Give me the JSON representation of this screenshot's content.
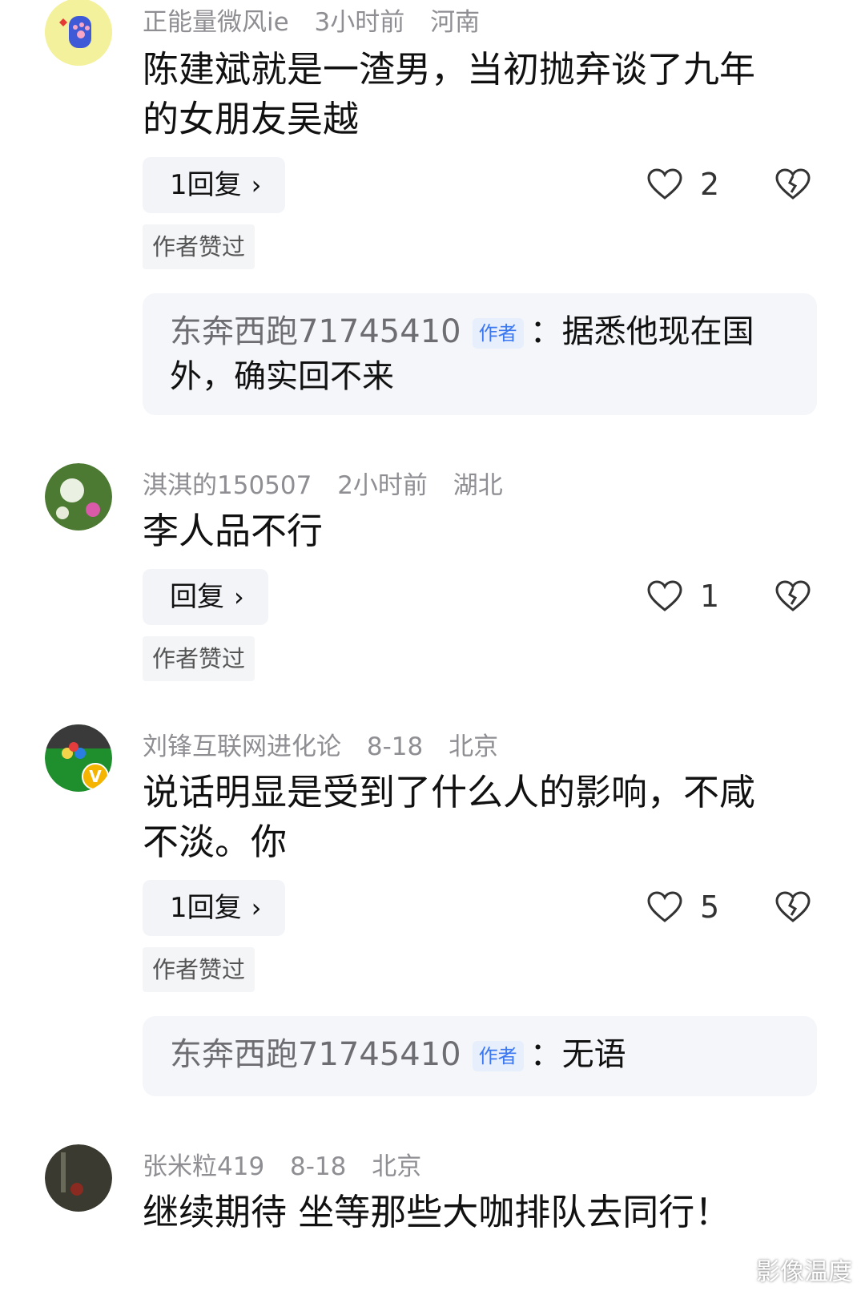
{
  "comments": [
    {
      "username": "正能量微风ie",
      "time": "3小时前",
      "location": "河南",
      "content_lines": [
        "陈建斌就是一渣男，当初抛弃谈了九年",
        "的女朋友吴越"
      ],
      "reply_button": "1回复",
      "likes": "2",
      "author_liked": "作者赞过",
      "sub_reply": {
        "username": "东奔西跑71745410",
        "tag": "作者",
        "lines": [
          "：据悉他现在国",
          "外，确实回不来"
        ]
      }
    },
    {
      "username": "淇淇的150507",
      "time": "2小时前",
      "location": "湖北",
      "content_lines": [
        "李人品不行"
      ],
      "reply_button": "回复",
      "likes": "1",
      "author_liked": "作者赞过"
    },
    {
      "username": "刘锋互联网进化论",
      "time": "8-18",
      "location": "北京",
      "content_lines": [
        "说话明显是受到了什么人的影响，不咸",
        "不淡。你"
      ],
      "reply_button": "1回复",
      "likes": "5",
      "author_liked": "作者赞过",
      "sub_reply": {
        "username": "东奔西跑71745410",
        "tag": "作者",
        "lines": [
          "：无语"
        ]
      }
    },
    {
      "username": "张米粒419",
      "time": "8-18",
      "location": "北京",
      "content_lines": [
        "继续期待 坐等那些大咖排队去同行！"
      ]
    }
  ],
  "watermark": "影像温度",
  "colors": {
    "meta_gray": "#8e8e93",
    "author_tag_blue": "#3a77f0",
    "panel_bg": "#f4f6f9"
  }
}
